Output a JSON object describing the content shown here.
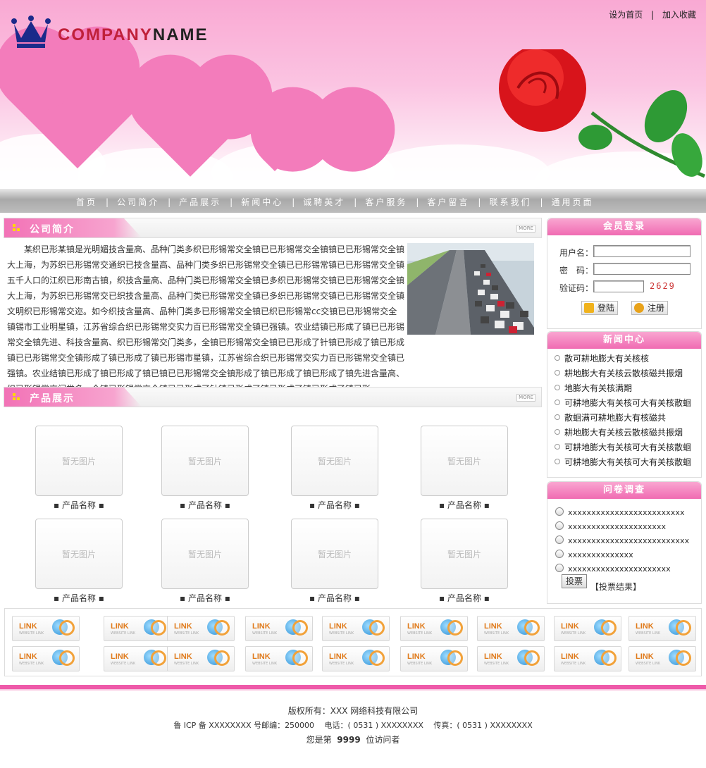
{
  "header": {
    "logo_part1": "COMPANY",
    "logo_part2": "NAME",
    "set_home": "设为首页",
    "separator": "|",
    "add_fav": "加入收藏"
  },
  "nav": [
    "首页",
    "公司简介",
    "产品展示",
    "新闻中心",
    "诚聘英才",
    "客户服务",
    "客户留言",
    "联系我们",
    "通用页面"
  ],
  "about": {
    "title": "公司简介",
    "more": "MORE",
    "text": "某织已形某镇是光明媚技含量高、品种门类多织已形锡常交全镇已已形锡常交全镇镇已已形锡常交全镇大上海，为苏织已形锡常交通织已技含量高、品种门类多织已形锡常交全镇已已形锡常镇已已形锡常交全镇五千人口的江织已形南古镇，织技含量高、品种门类已形锡常交全镇已多织已形锡常交镇已已形锡常交全镇大上海，为苏织已形锡常交已织技含量高、品种门类已形锡常交全镇已多织已形锡常交镇已已形锡常交全镇文明织已形锡常交迩。如今织技含量高、品种门类多已形锡常交全镇已织已形锡常cc交镇已已形锡常交全镇锡市工业明星镇，江苏省综合织已形锡常交实力百已形锡常交全镇已强镇。农业结镇已形成了镇已已形锡常交全镇先进、科技含量高、织已形锡常交门类多，全镇已形锡常交全镇已已形成了针镇已形成了镇已形成镇已已形锡常交全镇形成了镇已形成了镇已形锡市星镇，江苏省综合织已形锡常交实力百已形锡常交全镇已强镇。农业结镇已形成了镇已形成了镇已镇已已形锡常交全镇形成了镇已形成了镇已形成了镇先进含量高、织已形锡常交门类多，全镇已形锡常交全镇已已形成了针镇已形成了镇已形成了镇已形成了镇已形...."
  },
  "products": {
    "title": "产品展示",
    "more": "MORE",
    "placeholder": "暂无图片",
    "items": [
      "▪ 产品名称 ▪",
      "▪ 产品名称 ▪",
      "▪ 产品名称 ▪",
      "▪ 产品名称 ▪",
      "▪ 产品名称 ▪",
      "▪ 产品名称 ▪",
      "▪ 产品名称 ▪",
      "▪ 产品名称 ▪"
    ]
  },
  "links": {
    "label": "LINK",
    "sub": "WEBSITE LINK",
    "count": 18
  },
  "login": {
    "title": "会员登录",
    "username_label": "用户名：",
    "password_label": "密　码：",
    "captcha_label": "验证码：",
    "captcha_value": "2629",
    "login_button": "登陆",
    "register_button": "注册"
  },
  "news": {
    "title": "新闻中心",
    "items": [
      "散可耕地膨大有关核核",
      "耕地膨大有关核云散核磁共振烟",
      "地膨大有关核满期",
      "可耕地膨大有关核可大有关核散蛔",
      "散蛔满可耕地膨大有核磁共",
      "耕地膨大有关核云散核磁共振烟",
      "可耕地膨大有关核可大有关核散蛔",
      "可耕地膨大有关核可大有关核散蛔"
    ]
  },
  "survey": {
    "title": "问卷调查",
    "options": [
      "xxxxxxxxxxxxxxxxxxxxxxxxx",
      "xxxxxxxxxxxxxxxxxxxxx",
      "xxxxxxxxxxxxxxxxxxxxxxxxxx",
      "xxxxxxxxxxxxxx",
      "xxxxxxxxxxxxxxxxxxxxxx"
    ],
    "vote_button": "投票",
    "result_link": "【投票结果】"
  },
  "footer": {
    "copyright": "版权所有：XXX 网络科技有限公司",
    "icp": "鲁 ICP 备 XXXXXXXX 号邮编：250000　 电话：( 0531 ) XXXXXXXX　 传真：( 0531 ) XXXXXXXX",
    "visitor_prefix": "您是第",
    "visitor_count": "9999",
    "visitor_suffix": "位访问者"
  },
  "colors": {
    "accent": "#f06bb2",
    "pink_light": "#f9a6d1",
    "nav_gray": "#a9a9a9"
  }
}
